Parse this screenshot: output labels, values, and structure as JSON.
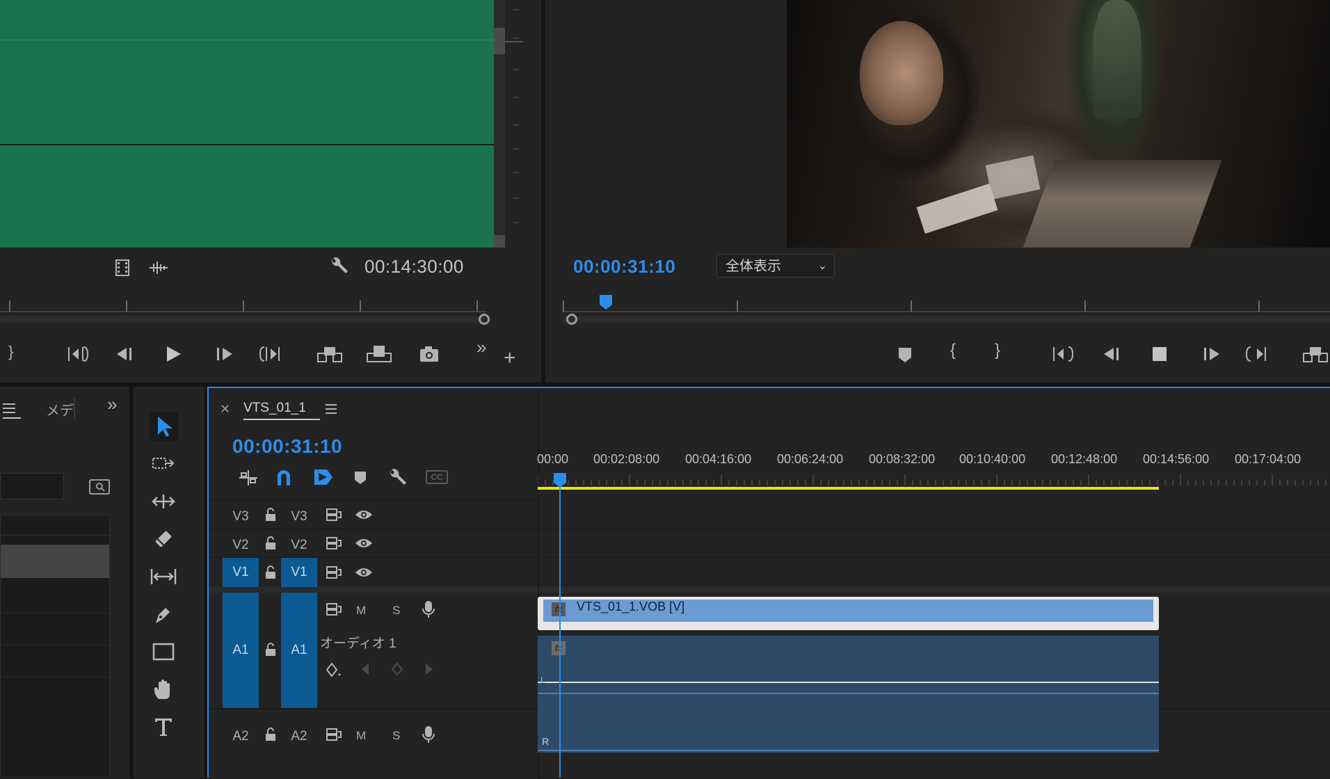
{
  "source_monitor": {
    "timecode": "00:14:30:00",
    "icons": [
      "film-icon",
      "audio-waveform-icon",
      "wrench-icon"
    ]
  },
  "program_monitor": {
    "timecode": "00:00:31:10",
    "zoom": "全体表示"
  },
  "project_panel": {
    "tab_label": "メデ",
    "overflow": "»"
  },
  "timeline": {
    "sequence_name": "VTS_01_1",
    "timecode": "00:00:31:10",
    "ruler": [
      "00:00",
      "00:02:08:00",
      "00:04:16:00",
      "00:06:24:00",
      "00:08:32:00",
      "00:10:40:00",
      "00:12:48:00",
      "00:14:56:00",
      "00:17:04:00"
    ],
    "tracks": {
      "v3": {
        "src": "V3",
        "tgt": "V3"
      },
      "v2": {
        "src": "V2",
        "tgt": "V2"
      },
      "v1": {
        "src": "V1",
        "tgt": "V1"
      },
      "a1": {
        "src": "A1",
        "tgt": "A1",
        "name": "オーディオ 1",
        "m": "M",
        "s": "S"
      },
      "a2": {
        "src": "A2",
        "tgt": "A2",
        "m": "M",
        "s": "S"
      }
    },
    "clip_video": "VTS_01_1.VOB [V]",
    "fx": "fx",
    "channel_l": "L",
    "channel_r": "R",
    "cc": "CC"
  },
  "colors": {
    "accent": "#2d8ceb",
    "clip_video": "#6b9bd3",
    "clip_audio": "#2d4b69",
    "work_area": "#e8e800"
  }
}
